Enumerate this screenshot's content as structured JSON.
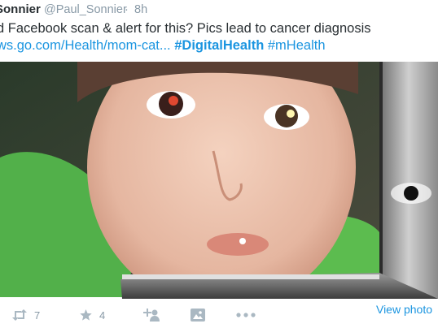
{
  "tweet": {
    "author_name": "Sonnier",
    "handle": "@Paul_Sonnier",
    "separator": "·",
    "time": "8h",
    "text_line1": "d Facebook scan & alert for this? Pics lead to cancer diagnosis",
    "link_text": "ws.go.com/Health/mom-cat...",
    "hashtag1": "#DigitalHealth",
    "hashtag2": "#mHealth"
  },
  "actions": {
    "retweet_count": "7",
    "favorite_count": "4",
    "view_photo_label": "View photo"
  },
  "colors": {
    "link": "#1b95e0",
    "muted": "#8899a6",
    "icon": "#aab8c2",
    "text": "#292f33"
  },
  "icons": [
    "retweet-icon",
    "favorite-star-icon",
    "follow-user-icon",
    "photo-icon",
    "more-options-icon"
  ]
}
